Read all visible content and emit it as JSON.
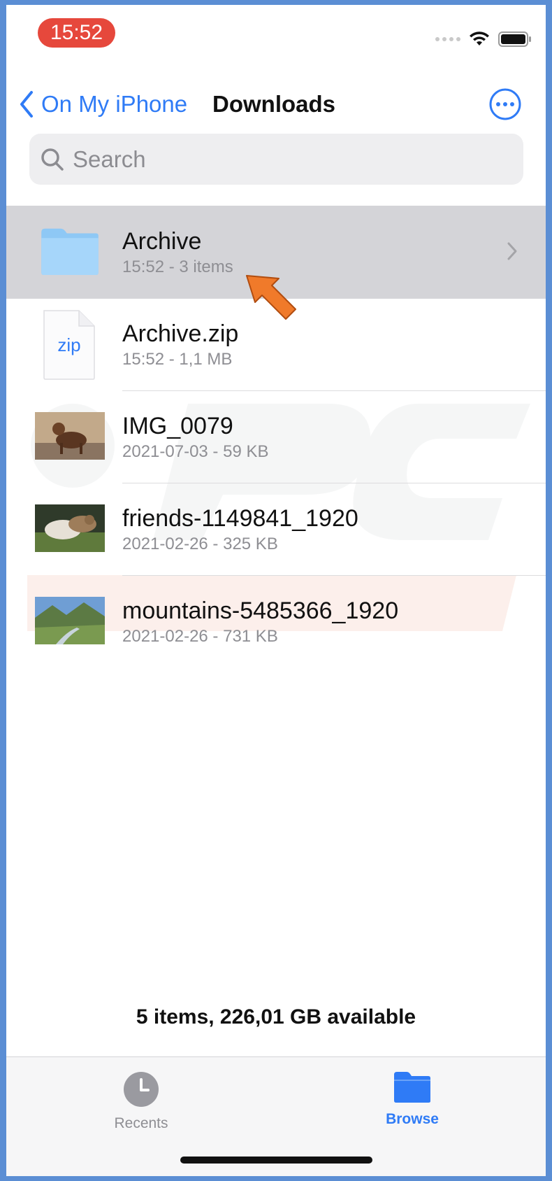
{
  "status_bar": {
    "time": "15:52"
  },
  "nav": {
    "back_label": "On My iPhone",
    "title": "Downloads"
  },
  "search": {
    "placeholder": "Search"
  },
  "files": [
    {
      "name": "Archive",
      "meta": "15:52 - 3 items",
      "icon": "folder-icon",
      "selected": true
    },
    {
      "name": "Archive.zip",
      "meta": "15:52 - 1,1 MB",
      "icon": "zip-file-icon",
      "icon_text": "zip"
    },
    {
      "name": "IMG_0079",
      "meta": "2021-07-03 - 59 KB",
      "icon": "photo-thumbnail"
    },
    {
      "name": "friends-1149841_1920",
      "meta": "2021-02-26 - 325 KB",
      "icon": "photo-thumbnail"
    },
    {
      "name": "mountains-5485366_1920",
      "meta": "2021-02-26 - 731 KB",
      "icon": "photo-thumbnail"
    }
  ],
  "footer": {
    "status": "5 items, 226,01 GB available"
  },
  "tabs": [
    {
      "label": "Recents",
      "icon": "clock-icon",
      "active": false
    },
    {
      "label": "Browse",
      "icon": "folder-icon",
      "active": true
    }
  ],
  "colors": {
    "accent": "#2f7bf6",
    "time_pill": "#e6483c",
    "selected_row": "#d4d4d8",
    "arrow": "#f07a2a"
  }
}
